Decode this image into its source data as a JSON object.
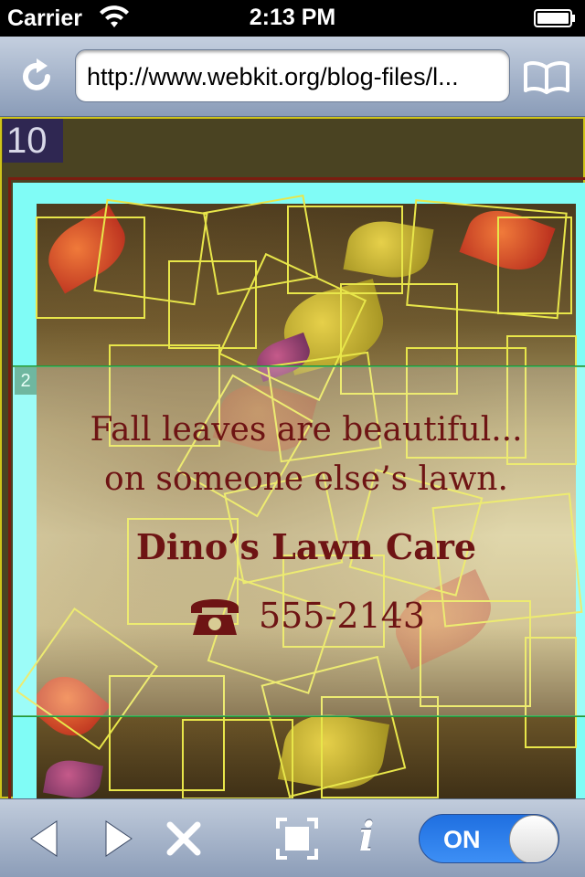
{
  "status_bar": {
    "carrier": "Carrier",
    "time": "2:13 PM",
    "wifi_icon": "wifi-icon",
    "battery_icon": "battery-icon"
  },
  "nav_bar": {
    "url": "http://www.webkit.org/blog-files/l...",
    "reload_icon": "reload-icon",
    "bookmarks_icon": "bookmarks-icon"
  },
  "content": {
    "layer_count": "10",
    "layer_badge": "2",
    "ad": {
      "tagline_line1": "Fall leaves are beautiful...",
      "tagline_line2": "on someone else’s lawn.",
      "business_name": "Dino’s Lawn Care",
      "phone": "555-2143",
      "phone_icon": "phone-icon"
    },
    "colors": {
      "ad_text": "#6e1414",
      "tile_border": "#e8e64a",
      "debug_frame": "#cfc41a",
      "cyan_panel": "#80fcf6"
    }
  },
  "toolbar": {
    "back_icon": "back-icon",
    "forward_icon": "forward-icon",
    "stop_icon": "stop-icon",
    "fullscreen_icon": "fullscreen-icon",
    "info_label": "i",
    "toggle_label": "ON"
  }
}
